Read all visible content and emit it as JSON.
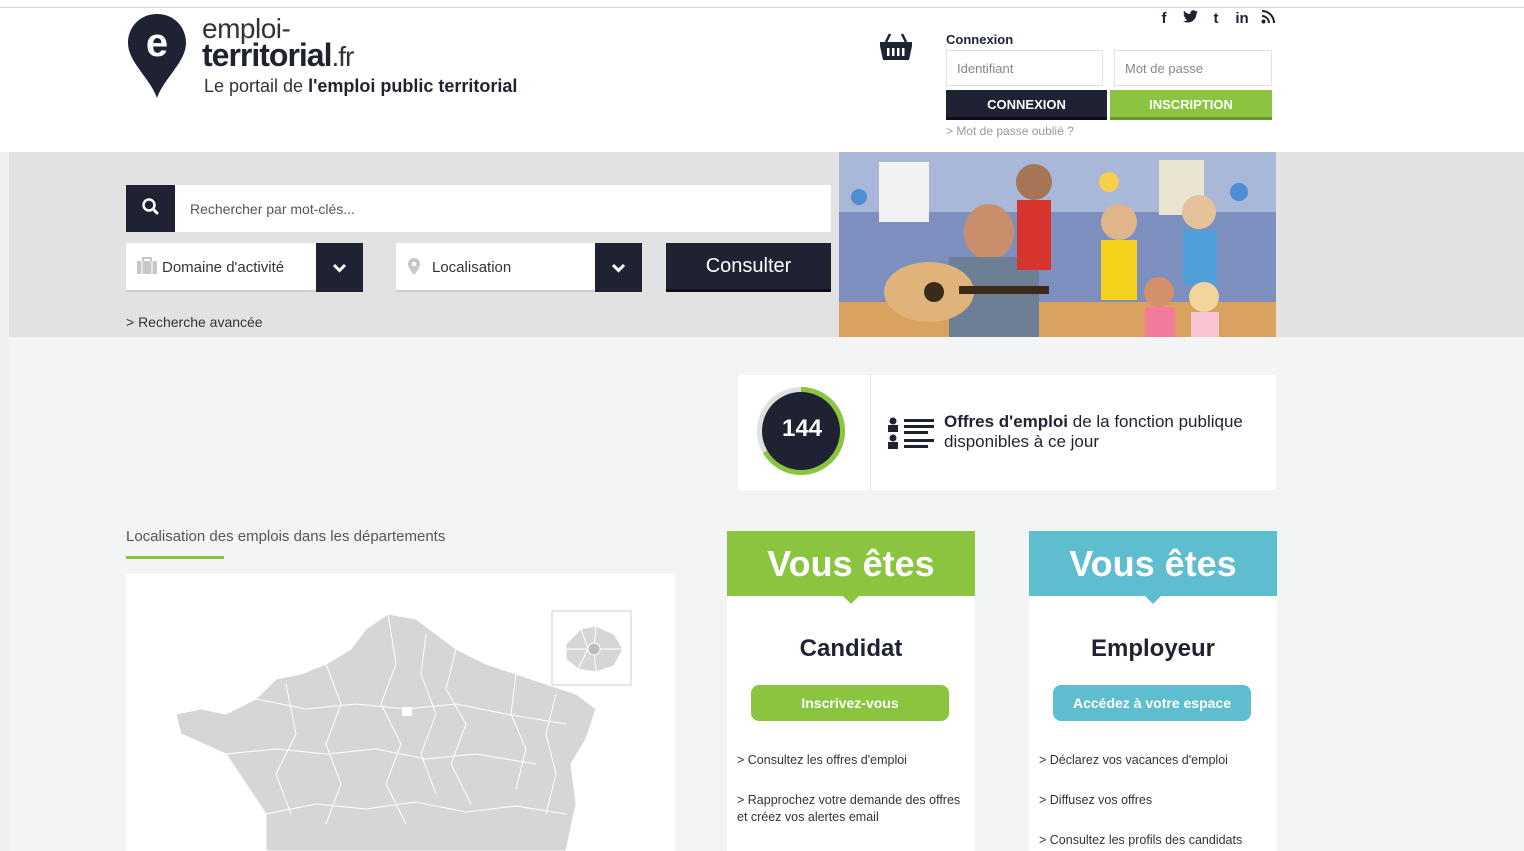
{
  "header": {
    "logo_line1": "emploi-",
    "logo_line2": "territorial",
    "logo_tld": ".fr",
    "tagline_prefix": "Le portail de ",
    "tagline_bold": "l'emploi public territorial",
    "social": [
      "f",
      "🐦",
      "t",
      "in",
      "rss"
    ]
  },
  "login": {
    "title": "Connexion",
    "user_placeholder": "Identifiant",
    "pass_placeholder": "Mot de passe",
    "connexion_label": "CONNEXION",
    "inscription_label": "INSCRIPTION",
    "forgot_label": "> Mot de passe oublié ?"
  },
  "search": {
    "placeholder": "Rechercher par mot-clés...",
    "domain_label": "Domaine d'activité",
    "location_label": "Localisation",
    "submit_label": "Consulter",
    "advanced_label": "> Recherche avancée"
  },
  "counter": {
    "value": "144",
    "text_bold": "Offres d'emploi",
    "text_rest_line1": " de la fonction publique",
    "text_line2": "disponibles à ce jour"
  },
  "map": {
    "title": "Localisation des emplois dans les départements"
  },
  "cards": {
    "candidate": {
      "head": "Vous êtes",
      "title": "Candidat",
      "button": "Inscrivez-vous",
      "links": [
        "> Consultez les offres d'emploi",
        "> Rapprochez votre demande des offres et créez vos alertes email"
      ]
    },
    "employer": {
      "head": "Vous êtes",
      "title": "Employeur",
      "button": "Accédez à votre espace",
      "links": [
        "> Déclarez vos vacances d'emploi",
        "> Diffusez vos offres",
        "> Consultez les profils des candidats"
      ]
    }
  },
  "colors": {
    "navy": "#1e2233",
    "green": "#8bc53f",
    "blue": "#5fbdd0"
  }
}
